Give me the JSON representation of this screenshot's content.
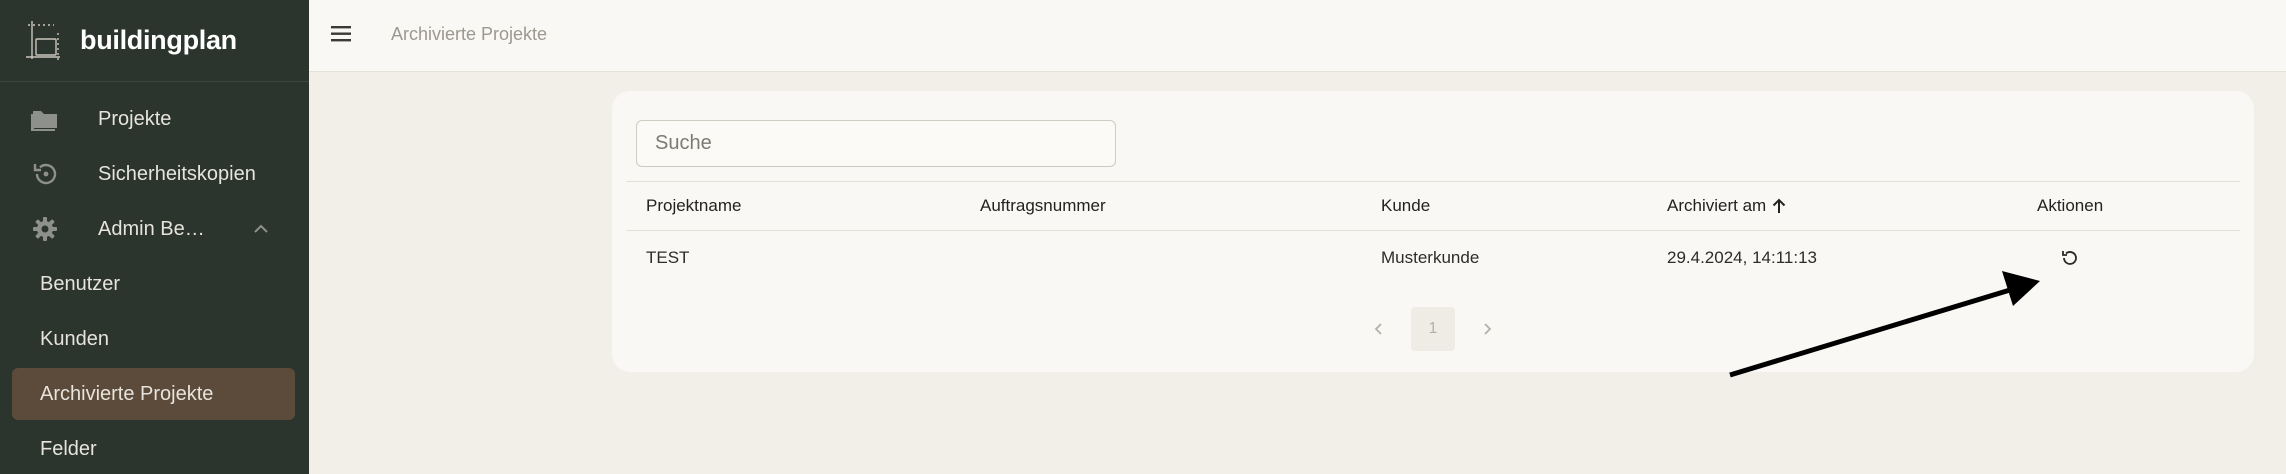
{
  "app": {
    "name": "buildingplan"
  },
  "sidebar": {
    "items": [
      {
        "label": "Projekte",
        "icon": "folder-icon"
      },
      {
        "label": "Sicherheitskopien",
        "icon": "backup-history-icon"
      },
      {
        "label": "Admin Be…",
        "icon": "gear-icon"
      }
    ],
    "sub_items": [
      {
        "label": "Benutzer"
      },
      {
        "label": "Kunden"
      },
      {
        "label": "Archivierte Projekte",
        "active": true
      },
      {
        "label": "Felder"
      }
    ]
  },
  "topbar": {
    "title": "Archivierte Projekte"
  },
  "search": {
    "placeholder": "Suche",
    "value": ""
  },
  "table": {
    "columns": [
      "Projektname",
      "Auftragsnummer",
      "Kunde",
      "Archiviert am",
      "Aktionen"
    ],
    "sort": {
      "column": "Archiviert am",
      "direction": "ascending"
    },
    "rows": [
      {
        "projektname": "TEST",
        "auftragsnummer": "",
        "kunde": "Musterkunde",
        "archiviert_am": "29.4.2024, 14:11:13",
        "action_icon": "restore-icon"
      }
    ]
  },
  "pagination": {
    "current_page": "1"
  },
  "colors": {
    "sidebar_bg": "#2b342d",
    "active_item_bg": "#5c4a3b",
    "page_bg": "#f2efe9",
    "card_bg": "#f9f8f4"
  }
}
